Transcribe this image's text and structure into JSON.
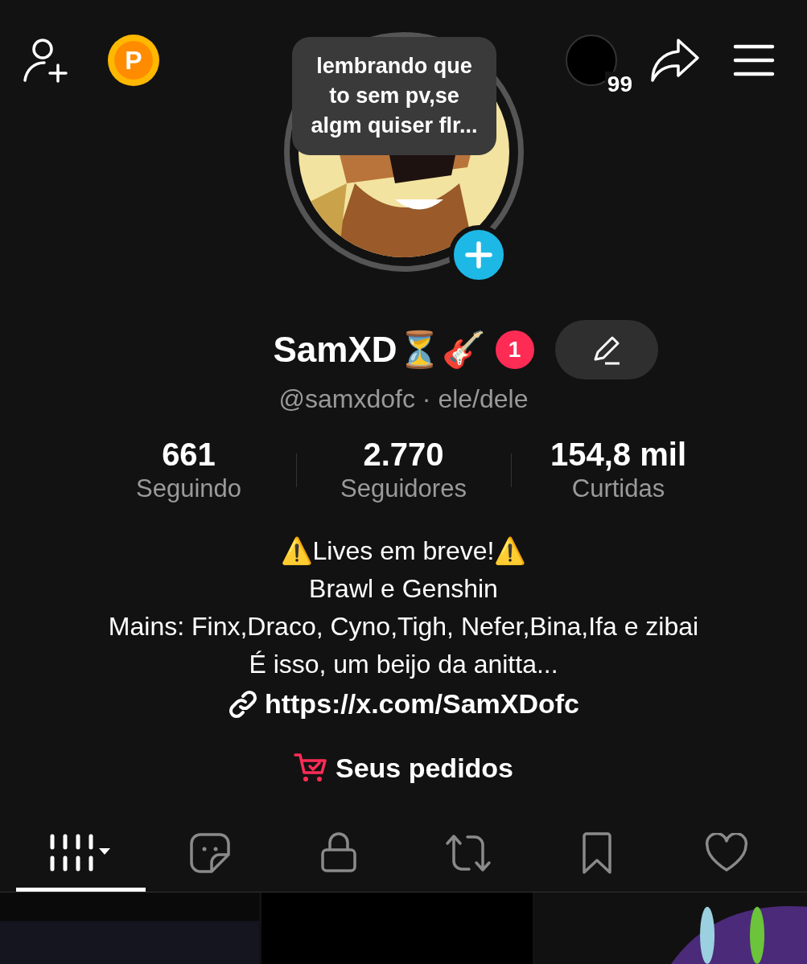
{
  "top_bar": {
    "points_badge": "P",
    "tooltip": "lembrando que to sem pv,se algm quiser flr...",
    "notification_count": "99"
  },
  "profile": {
    "name": "SamXD⏳🎸",
    "badge_count": "1",
    "handle": "@samxdofc · ele/dele"
  },
  "stats": [
    {
      "value": "661",
      "label": "Seguindo"
    },
    {
      "value": "2.770",
      "label": "Seguidores"
    },
    {
      "value": "154,8 mil",
      "label": "Curtidas"
    }
  ],
  "bio": [
    "⚠️Lives em breve!⚠️",
    "Brawl e Genshin",
    "Mains: Finx,Draco, Cyno,Tigh, Nefer,Bina,Ifa e zibai",
    "É isso, um beijo da anitta..."
  ],
  "link": "https://x.com/SamXDofc",
  "orders": "Seus pedidos",
  "tabs": [
    {
      "kind": "grid",
      "selected": true
    },
    {
      "kind": "sticker",
      "selected": false
    },
    {
      "kind": "lock",
      "selected": false
    },
    {
      "kind": "repost",
      "selected": false
    },
    {
      "kind": "bookmark",
      "selected": false
    },
    {
      "kind": "heart",
      "selected": false
    }
  ]
}
